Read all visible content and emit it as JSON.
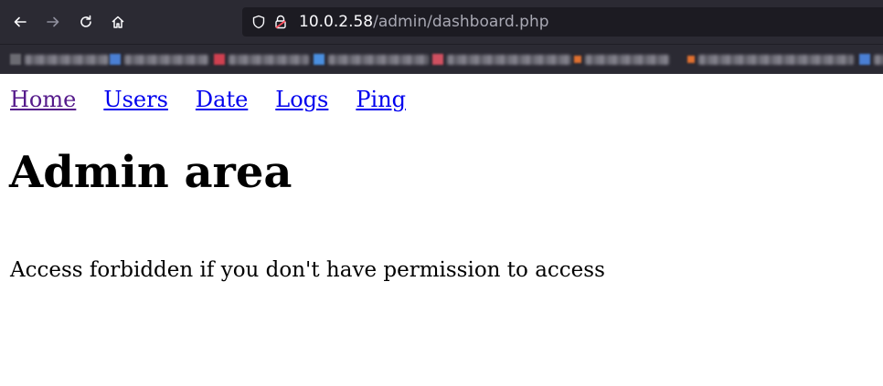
{
  "browser": {
    "url_host": "10.0.2.58",
    "url_path": "/admin/dashboard.php",
    "icons": [
      "back-arrow-icon",
      "forward-arrow-icon",
      "reload-icon",
      "home-icon",
      "shield-icon",
      "lock-warning-icon"
    ]
  },
  "bookmarks": [
    {
      "color": "#6b6b72"
    },
    {
      "color": "#4a7fd4"
    },
    {
      "color": "#d04050"
    },
    {
      "color": "#4a8fe0"
    },
    {
      "color": "#d05060"
    },
    {
      "color": "#e07030"
    },
    {
      "color": "#e07030"
    },
    {
      "color": "#4a7fd4"
    }
  ],
  "nav": {
    "home": "Home",
    "users": "Users",
    "date": "Date",
    "logs": "Logs",
    "ping": "Ping"
  },
  "main": {
    "title": "Admin area",
    "message": "Access forbidden if you don't have permission to access"
  },
  "colors": {
    "link": "#0000ee",
    "visited_link": "#551a8b",
    "chrome_bg": "#2b2a33",
    "urlbar_bg": "#1c1b22"
  }
}
